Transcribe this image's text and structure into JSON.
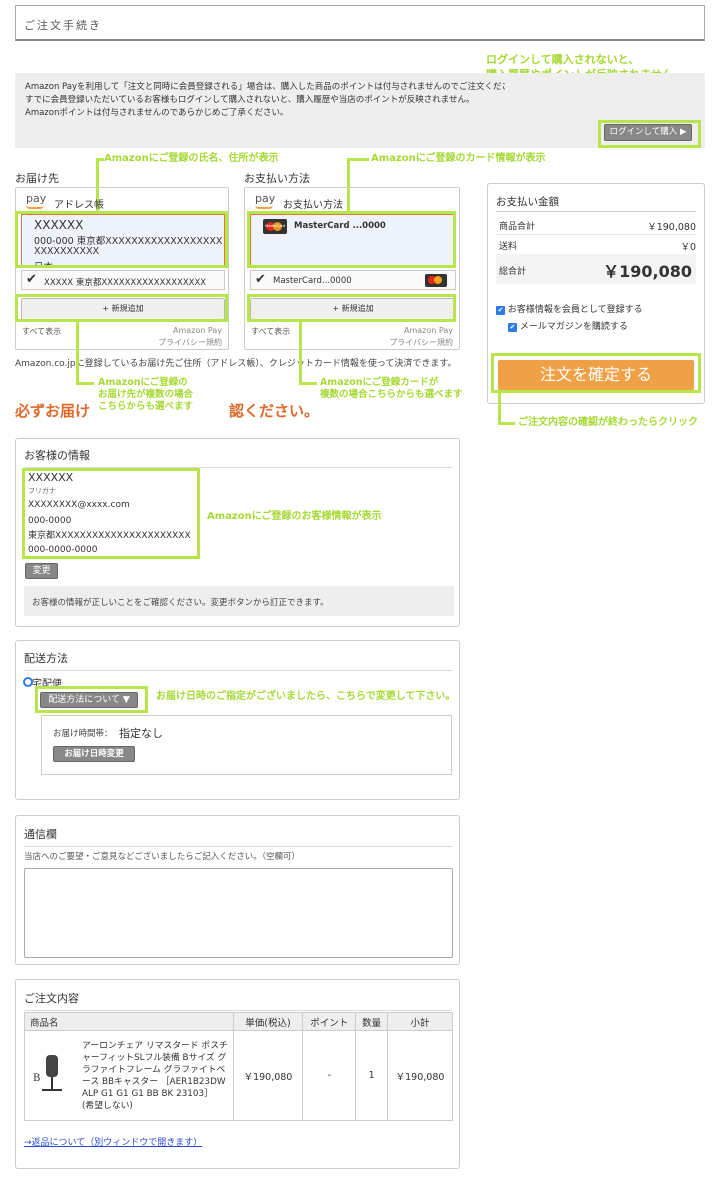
{
  "page_title": "ご注文手続き",
  "top_annotation": {
    "line1": "ログインして購入されないと、",
    "line2": "購入履歴やポイントが反映されません。"
  },
  "notice": {
    "line1": "Amazon Payを利用して「注文と同時に会員登録される」場合は、購入した商品のポイントは付与されませんのでご注文ください。",
    "line2": "すでに会員登録いただいているお客様もログインして購入されないと、購入履歴や当店のポイントが反映されません。",
    "line3": "Amazonポイントは付与されませんのであらかじめご了承ください。",
    "login_button": "ログインして購入 ▶"
  },
  "annotations": {
    "address_top": "Amazonにご登録の氏名、住所が表示",
    "card_top": "Amazonにご登録のカード情報が表示",
    "address_bottom": [
      "Amazonにご登録の",
      "お届け先が複数の場合",
      "こちらからも選べます"
    ],
    "card_bottom": [
      "Amazonにご登録カードが",
      "複数の場合こちらからも選べます"
    ],
    "customer": "Amazonにご登録のお客様情報が表示",
    "delivery": "お届け日時のご指定がございましたら、こちらで変更して下さい。",
    "confirm": "ご注文内容の確認が終わったらクリック"
  },
  "shipping": {
    "heading": "お届け先",
    "pay_logo": "pay",
    "widget_title": "アドレス帳",
    "selected": {
      "name": "XXXXXX",
      "line1": "000-000 東京都XXXXXXXXXXXXXXXXXX",
      "line2": "XXXXXXXXXX",
      "line3": "日本"
    },
    "alt": "XXXXX 東京都XXXXXXXXXXXXXXXXXX",
    "add": "+ 新規追加",
    "show_all": "すべて表示",
    "footer1": "Amazon Pay",
    "footer2": "プライバシー規約"
  },
  "payment": {
    "heading": "お支払い方法",
    "pay_logo": "pay",
    "widget_title": "お支払い方法",
    "card_brand": "MasterCard",
    "selected": "MasterCard ...0000",
    "alt": "MasterCard...0000",
    "add": "+ 新規追加",
    "show_all": "すべて表示",
    "footer1": "Amazon Pay",
    "footer2": "プライバシー規約"
  },
  "amazon_note": "Amazon.co.jpに登録しているお届け先ご住所（アドレス帳）、クレジットカード情報を使って決済できます。",
  "red_warning_left": "必ずお届け",
  "red_warning_right": "認ください。",
  "summary": {
    "heading": "お支払い金額",
    "rows": [
      {
        "label": "商品合計",
        "value": "￥190,080"
      },
      {
        "label": "送料",
        "value": "￥0"
      }
    ],
    "total_label": "総合計",
    "total_value": "￥190,080",
    "check_member": "お客様情報を会員として登録する",
    "check_mail": "メールマガジンを購読する",
    "confirm_button": "注文を確定する"
  },
  "customer": {
    "heading": "お客様の情報",
    "name": "XXXXXX",
    "furigana": "フリガナ",
    "email": "XXXXXXXX@xxxx.com",
    "zip": "000-0000",
    "address": "東京都XXXXXXXXXXXXXXXXXXXXXX",
    "phone": "000-0000-0000",
    "change": "変更",
    "note": "お客様の情報が正しいことをご確認ください。変更ボタンから訂正できます。"
  },
  "delivery": {
    "heading": "配送方法",
    "method": "宅配便",
    "about_button": "配送方法について ▼",
    "time_label": "お届け時間帯：",
    "time_value": "指定なし",
    "change_button": "お届け日時変更"
  },
  "message": {
    "heading": "通信欄",
    "hint": "当店へのご要望・ご意見などございましたらご記入ください。（空欄可）"
  },
  "order": {
    "heading": "ご注文内容",
    "columns": [
      "商品名",
      "単価(税込)",
      "ポイント",
      "数量",
      "小計"
    ],
    "item": {
      "name": "アーロンチェア リマスタード ポスチャーフィットSLフル装備 Bサイズ グラファイトフレーム グラファイトベース BBキャスター ［AER1B23DW ALP G1 G1 G1 BB BK 23103］",
      "gift": "(希望しない)",
      "size_badge": "B",
      "price": "￥190,080",
      "points": "-",
      "qty": "1",
      "subtotal": "￥190,080"
    },
    "return_link": "→返品について（別ウィンドウで開きます）"
  },
  "colors": {
    "accent_green": "#b6e64c",
    "confirm_orange": "#f0a045",
    "warning_red": "#e06a2c"
  }
}
